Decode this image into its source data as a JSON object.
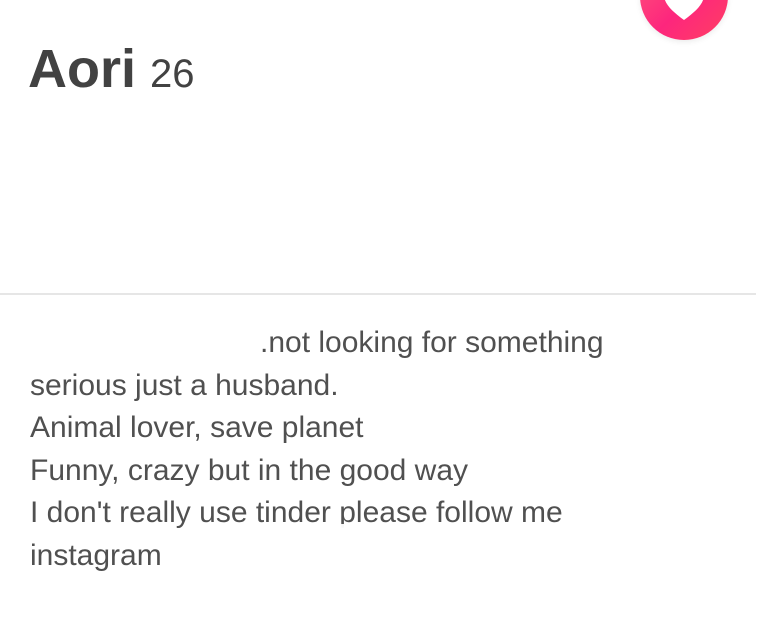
{
  "profile": {
    "name": "Aori",
    "age": "26"
  },
  "bio": {
    "lines": [
      ".not looking for something",
      "serious just a husband.",
      "Animal lover, save planet",
      "Funny, crazy but in the good way",
      "I don't really use tinder please follow me",
      "instagram"
    ]
  },
  "like_button": {
    "icon": "heart-icon",
    "color": "#fd267d"
  },
  "colors": {
    "text": "#424242",
    "divider": "#e6e6e6",
    "accent": "#fd267d"
  }
}
